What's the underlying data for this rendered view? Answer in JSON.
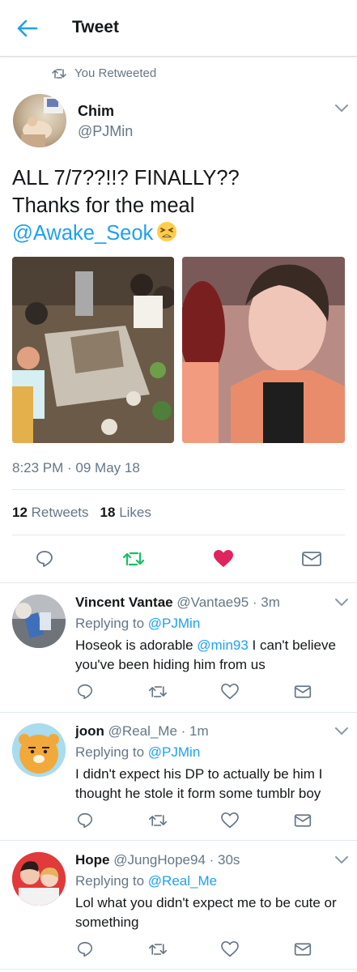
{
  "header": {
    "title": "Tweet"
  },
  "retweet_context": {
    "label": "You Retweeted"
  },
  "tweet": {
    "author_name": "Chim",
    "author_handle": "@PJMin",
    "text_line1": "ALL 7/7??!!? FINALLY??",
    "text_line2": "Thanks for the meal",
    "mention": "@Awake_Seok",
    "emoji": "tired-face-emoji",
    "timestamp": "8:23 PM · 09 May 18",
    "retweets_count": "12",
    "retweets_label": "Retweets",
    "likes_count": "18",
    "likes_label": "Likes",
    "liked": true,
    "retweeted": true,
    "colors": {
      "accent": "#1da1f2",
      "retweet": "#17bf63",
      "like": "#e0245e"
    }
  },
  "replies": [
    {
      "name": "Vincent Vantae",
      "handle": "@Vantae95",
      "time": "· 3m",
      "replying_prefix": "Replying to",
      "replying_to": "@PJMin",
      "text_before": "Hoseok is adorable ",
      "text_mention": "@min93",
      "text_after": " I can't believe you've been hiding him from us"
    },
    {
      "name": "joon",
      "handle": "@Real_Me",
      "time": "· 1m",
      "replying_prefix": "Replying to",
      "replying_to": "@PJMin",
      "text": "I didn't expect his DP to actually be him I thought he stole it form some tumblr boy"
    },
    {
      "name": "Hope",
      "handle": "@JungHope94",
      "time": "· 30s",
      "replying_prefix": "Replying to",
      "replying_to": "@Real_Me",
      "text": "Lol what you didn't expect me to be cute or something"
    }
  ]
}
